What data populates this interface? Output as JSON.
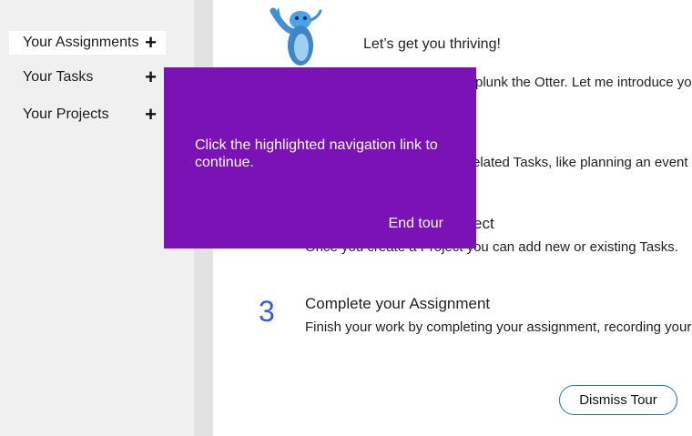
{
  "sidebar": {
    "items": [
      {
        "label": "Your Assignments",
        "icon": "plus-icon"
      },
      {
        "label": "Your Tasks",
        "icon": "plus-icon"
      },
      {
        "label": "Your Projects",
        "icon": "plus-icon"
      }
    ]
  },
  "main": {
    "welcome_title": "Let’s get you thriving!",
    "intro_partial": "plunk the Otter. Let me introduce you",
    "step1_desc_partial": "elated Tasks, like planning an event",
    "step2_title_partial": "ect",
    "step2_desc": "Once you create a Project you can add new or existing Tasks.",
    "step3_number": "3",
    "step3_title": "Complete your Assignment",
    "step3_desc": "Finish your work by completing your assignment, recording your",
    "dismiss_label": "Dismiss Tour"
  },
  "tour": {
    "message": "Click the highlighted navigation link to continue.",
    "end_label": "End tour"
  },
  "colors": {
    "tour_bg": "#7b12b5",
    "accent_number": "#3b5bdb",
    "button_border": "#2a6ad0",
    "sidebar_bg": "#f0f0f0"
  }
}
